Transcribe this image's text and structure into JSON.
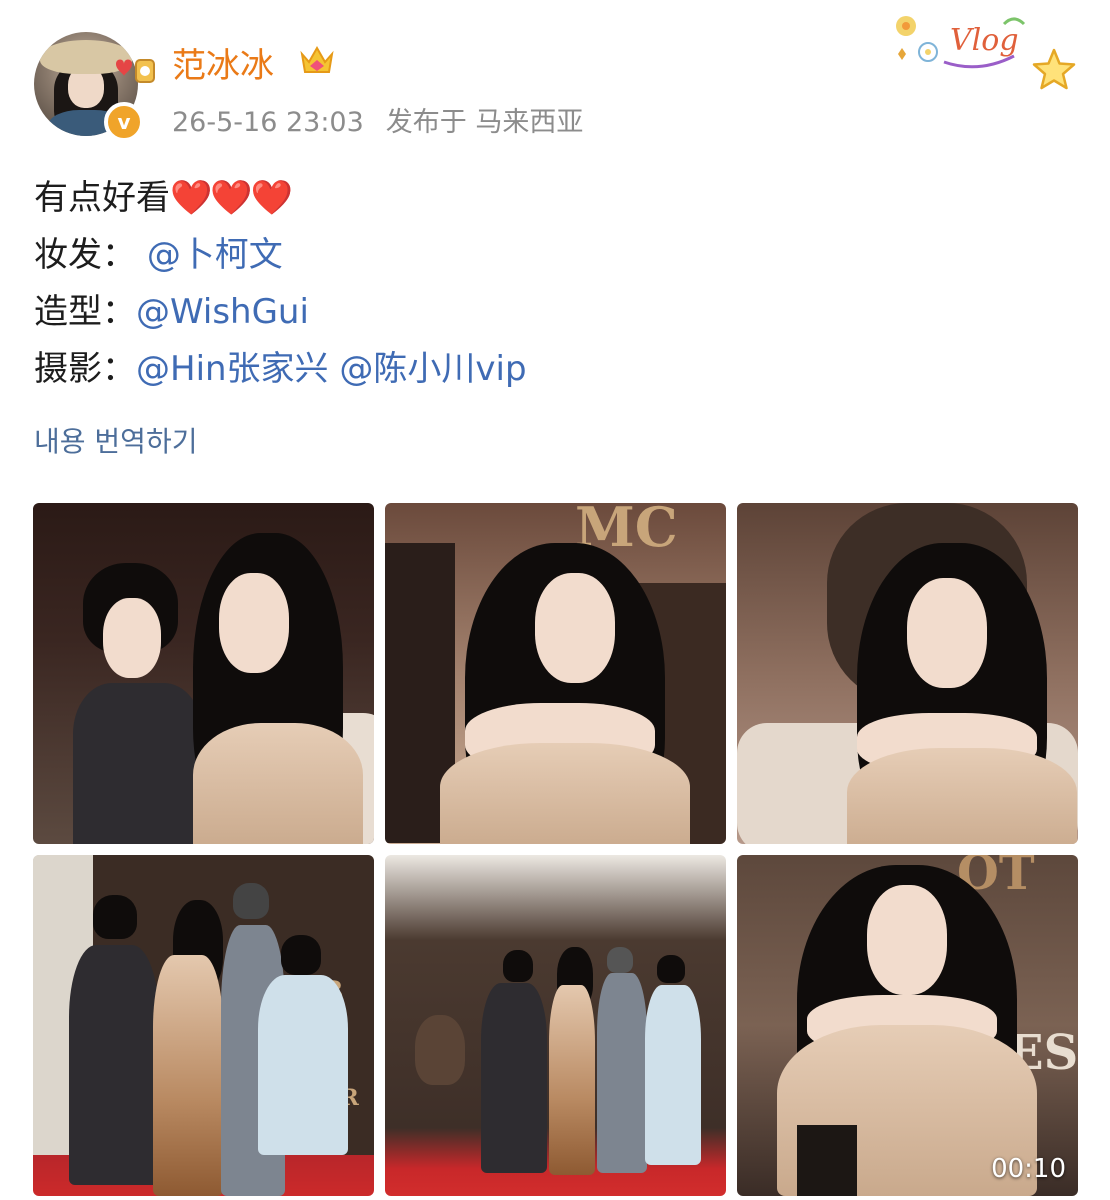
{
  "user": {
    "name": "范冰冰",
    "timestamp": "26-5-16 23:03",
    "location": "发布于 马来西亚",
    "badge": "v"
  },
  "post": {
    "line1_text": "有点好看",
    "line1_emoji": "❤️❤️❤️",
    "makeup_label": "妆发：",
    "makeup_mention": "@卜柯文",
    "styling_label": "造型：",
    "styling_mention": "@WishGui",
    "photo_label": "摄影：",
    "photo_mention_1": "@Hin张家兴",
    "photo_mention_2": "@陈小川vip"
  },
  "translate_link": "내용 번역하기",
  "sticker_text": "Vlog",
  "icons": {
    "crown": "crown-icon",
    "star": "star-icon",
    "verify": "verified-badge-icon"
  },
  "media": {
    "video_duration": "00:10"
  },
  "colors": {
    "username": "#ea7a17",
    "mention": "#3f6bb4",
    "meta": "#8c8c8c",
    "translate": "#4d6e9a",
    "verify": "#f0a42a"
  }
}
